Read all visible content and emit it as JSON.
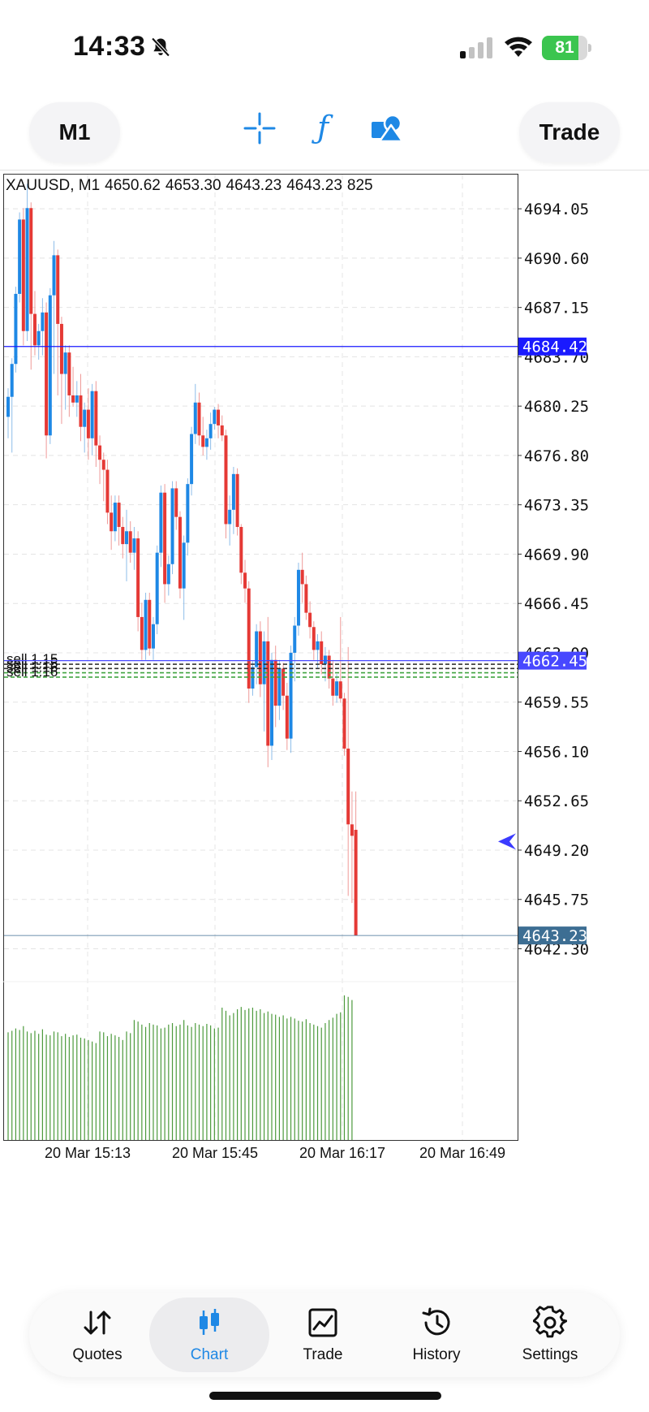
{
  "status_bar": {
    "time": "14:33",
    "battery": "81",
    "battery_level": 0.81,
    "bell_icon": "bell-slash-icon",
    "battery_color": "#3bc54f"
  },
  "toolbar": {
    "timeframe": "M1",
    "trade_label": "Trade",
    "icons": [
      "crosshair-icon",
      "indicator-f-icon",
      "objects-shapes-icon"
    ],
    "accent": "#1e88e5"
  },
  "chart_header": {
    "symbol": "XAUUSD",
    "timeframe": "M1",
    "open": "4650.62",
    "high": "4653.30",
    "low": "4643.23",
    "close": "4643.23",
    "volume": "825"
  },
  "chart_data": {
    "type": "candlestick",
    "symbol": "XAUUSD",
    "y_axis_ticks": [
      "4694.05",
      "4690.60",
      "4687.15",
      "4683.70",
      "4680.25",
      "4676.80",
      "4673.35",
      "4669.90",
      "4666.45",
      "4663.00",
      "4659.55",
      "4656.10",
      "4652.65",
      "4649.20",
      "4645.75",
      "4642.30"
    ],
    "ylim": [
      4640,
      4696.5
    ],
    "x_axis_labels": [
      "20 Mar 15:13",
      "20 Mar 15:45",
      "20 Mar 16:17",
      "20 Mar 16:49"
    ],
    "price_lines": [
      {
        "label": "4684.42",
        "value": 4684.42,
        "color": "#1a1aff"
      },
      {
        "label": "4662.45",
        "value": 4662.45,
        "color": "#4848ff"
      },
      {
        "label": "4643.23",
        "value": 4643.23,
        "color": "#3d6e93"
      }
    ],
    "order_lines": [
      {
        "label": "sell 1.15",
        "value": 4662.2
      },
      {
        "label": "sell 1.15",
        "value": 4661.9
      },
      {
        "label": "sell 1.16",
        "value": 4661.6
      },
      {
        "label": "sell 1.16",
        "value": 4661.3
      }
    ],
    "up_color": "#1e88e5",
    "down_color": "#e53935",
    "volume_color": "#4c9a3c",
    "grid": true,
    "candles": [
      {
        "o": 4679.5,
        "h": 4681.5,
        "l": 4678.0,
        "c": 4680.9
      },
      {
        "o": 4680.9,
        "h": 4683.6,
        "l": 4677.0,
        "c": 4683.2
      },
      {
        "o": 4683.2,
        "h": 4688.6,
        "l": 4682.6,
        "c": 4688.1
      },
      {
        "o": 4688.1,
        "h": 4693.8,
        "l": 4687.5,
        "c": 4693.3
      },
      {
        "o": 4693.3,
        "h": 4694.1,
        "l": 4684.5,
        "c": 4685.5
      },
      {
        "o": 4685.5,
        "h": 4695.8,
        "l": 4684.8,
        "c": 4694.1
      },
      {
        "o": 4694.1,
        "h": 4694.5,
        "l": 4682.8,
        "c": 4686.7
      },
      {
        "o": 4686.7,
        "h": 4688.3,
        "l": 4683.8,
        "c": 4684.5
      },
      {
        "o": 4684.5,
        "h": 4686.0,
        "l": 4683.5,
        "c": 4685.5
      },
      {
        "o": 4685.5,
        "h": 4687.8,
        "l": 4683.8,
        "c": 4686.8
      },
      {
        "o": 4686.8,
        "h": 4687.5,
        "l": 4676.6,
        "c": 4678.2
      },
      {
        "o": 4678.2,
        "h": 4688.5,
        "l": 4677.6,
        "c": 4688.0
      },
      {
        "o": 4688.0,
        "h": 4691.8,
        "l": 4682.5,
        "c": 4690.8
      },
      {
        "o": 4690.8,
        "h": 4691.2,
        "l": 4681.0,
        "c": 4686.0
      },
      {
        "o": 4686.0,
        "h": 4686.5,
        "l": 4679.0,
        "c": 4682.5
      },
      {
        "o": 4682.5,
        "h": 4684.5,
        "l": 4680.0,
        "c": 4684.0
      },
      {
        "o": 4684.0,
        "h": 4684.5,
        "l": 4679.5,
        "c": 4681.0
      },
      {
        "o": 4681.0,
        "h": 4683.0,
        "l": 4680.2,
        "c": 4680.5
      },
      {
        "o": 4680.5,
        "h": 4682.0,
        "l": 4679.5,
        "c": 4681.0
      },
      {
        "o": 4681.0,
        "h": 4682.5,
        "l": 4677.8,
        "c": 4678.8
      },
      {
        "o": 4678.8,
        "h": 4680.5,
        "l": 4677.0,
        "c": 4680.0
      },
      {
        "o": 4680.0,
        "h": 4681.5,
        "l": 4676.5,
        "c": 4678.0
      },
      {
        "o": 4678.0,
        "h": 4681.8,
        "l": 4676.8,
        "c": 4681.3
      },
      {
        "o": 4681.3,
        "h": 4682.0,
        "l": 4676.0,
        "c": 4677.5
      },
      {
        "o": 4677.5,
        "h": 4678.2,
        "l": 4674.8,
        "c": 4676.5
      },
      {
        "o": 4676.5,
        "h": 4677.0,
        "l": 4673.6,
        "c": 4675.8
      },
      {
        "o": 4675.8,
        "h": 4676.5,
        "l": 4672.0,
        "c": 4672.8
      },
      {
        "o": 4672.8,
        "h": 4674.0,
        "l": 4670.2,
        "c": 4671.5
      },
      {
        "o": 4671.5,
        "h": 4674.0,
        "l": 4670.8,
        "c": 4673.5
      },
      {
        "o": 4673.5,
        "h": 4674.0,
        "l": 4670.5,
        "c": 4671.8
      },
      {
        "o": 4671.8,
        "h": 4672.5,
        "l": 4669.6,
        "c": 4670.6
      },
      {
        "o": 4670.6,
        "h": 4673.0,
        "l": 4668.0,
        "c": 4671.5
      },
      {
        "o": 4671.5,
        "h": 4672.2,
        "l": 4669.3,
        "c": 4670.0
      },
      {
        "o": 4670.0,
        "h": 4671.8,
        "l": 4668.8,
        "c": 4671.0
      },
      {
        "o": 4671.0,
        "h": 4671.5,
        "l": 4664.5,
        "c": 4665.5
      },
      {
        "o": 4665.5,
        "h": 4666.5,
        "l": 4662.5,
        "c": 4663.2
      },
      {
        "o": 4663.2,
        "h": 4667.2,
        "l": 4662.5,
        "c": 4666.7
      },
      {
        "o": 4666.7,
        "h": 4667.2,
        "l": 4662.8,
        "c": 4663.3
      },
      {
        "o": 4663.3,
        "h": 4665.5,
        "l": 4662.5,
        "c": 4665.0
      },
      {
        "o": 4665.0,
        "h": 4670.5,
        "l": 4664.3,
        "c": 4670.0
      },
      {
        "o": 4670.0,
        "h": 4674.7,
        "l": 4669.0,
        "c": 4674.2
      },
      {
        "o": 4674.2,
        "h": 4674.8,
        "l": 4666.5,
        "c": 4667.8
      },
      {
        "o": 4667.8,
        "h": 4669.8,
        "l": 4667.0,
        "c": 4669.2
      },
      {
        "o": 4669.2,
        "h": 4675.0,
        "l": 4668.5,
        "c": 4674.5
      },
      {
        "o": 4674.5,
        "h": 4675.0,
        "l": 4671.6,
        "c": 4672.5
      },
      {
        "o": 4672.5,
        "h": 4672.9,
        "l": 4666.8,
        "c": 4667.5
      },
      {
        "o": 4667.5,
        "h": 4671.2,
        "l": 4665.3,
        "c": 4670.7
      },
      {
        "o": 4670.7,
        "h": 4675.2,
        "l": 4669.8,
        "c": 4674.8
      },
      {
        "o": 4674.8,
        "h": 4678.8,
        "l": 4674.0,
        "c": 4678.3
      },
      {
        "o": 4678.3,
        "h": 4681.8,
        "l": 4677.6,
        "c": 4680.5
      },
      {
        "o": 4680.5,
        "h": 4681.2,
        "l": 4677.5,
        "c": 4678.2
      },
      {
        "o": 4678.2,
        "h": 4679.5,
        "l": 4676.8,
        "c": 4677.4
      },
      {
        "o": 4677.4,
        "h": 4678.6,
        "l": 4676.5,
        "c": 4678.0
      },
      {
        "o": 4678.0,
        "h": 4679.8,
        "l": 4677.2,
        "c": 4679.0
      },
      {
        "o": 4679.0,
        "h": 4680.2,
        "l": 4678.6,
        "c": 4680.0
      },
      {
        "o": 4680.0,
        "h": 4680.4,
        "l": 4678.0,
        "c": 4678.9
      },
      {
        "o": 4678.9,
        "h": 4679.6,
        "l": 4677.8,
        "c": 4678.2
      },
      {
        "o": 4678.2,
        "h": 4678.6,
        "l": 4671.0,
        "c": 4672.0
      },
      {
        "o": 4672.0,
        "h": 4674.0,
        "l": 4670.5,
        "c": 4673.0
      },
      {
        "o": 4673.0,
        "h": 4676.0,
        "l": 4671.3,
        "c": 4675.5
      },
      {
        "o": 4675.5,
        "h": 4675.9,
        "l": 4671.2,
        "c": 4671.8
      },
      {
        "o": 4671.8,
        "h": 4672.0,
        "l": 4667.8,
        "c": 4668.6
      },
      {
        "o": 4668.6,
        "h": 4669.5,
        "l": 4666.5,
        "c": 4667.5
      },
      {
        "o": 4667.5,
        "h": 4668.0,
        "l": 4659.5,
        "c": 4660.5
      },
      {
        "o": 4660.5,
        "h": 4662.4,
        "l": 4660.0,
        "c": 4662.0
      },
      {
        "o": 4662.0,
        "h": 4665.0,
        "l": 4660.8,
        "c": 4664.5
      },
      {
        "o": 4664.5,
        "h": 4665.2,
        "l": 4659.9,
        "c": 4660.8
      },
      {
        "o": 4660.8,
        "h": 4664.5,
        "l": 4657.5,
        "c": 4663.8
      },
      {
        "o": 4663.8,
        "h": 4665.5,
        "l": 4655.0,
        "c": 4656.5
      },
      {
        "o": 4656.5,
        "h": 4663.0,
        "l": 4655.5,
        "c": 4662.5
      },
      {
        "o": 4662.5,
        "h": 4663.5,
        "l": 4657.8,
        "c": 4659.3
      },
      {
        "o": 4659.3,
        "h": 4662.5,
        "l": 4658.3,
        "c": 4661.9
      },
      {
        "o": 4661.9,
        "h": 4662.3,
        "l": 4659.0,
        "c": 4660.0
      },
      {
        "o": 4660.0,
        "h": 4660.9,
        "l": 4656.2,
        "c": 4657.0
      },
      {
        "o": 4657.0,
        "h": 4663.5,
        "l": 4656.0,
        "c": 4663.0
      },
      {
        "o": 4663.0,
        "h": 4665.5,
        "l": 4661.0,
        "c": 4664.9
      },
      {
        "o": 4664.9,
        "h": 4669.3,
        "l": 4664.2,
        "c": 4668.8
      },
      {
        "o": 4668.8,
        "h": 4670.0,
        "l": 4666.5,
        "c": 4667.8
      },
      {
        "o": 4667.8,
        "h": 4668.4,
        "l": 4665.3,
        "c": 4665.8
      },
      {
        "o": 4665.8,
        "h": 4666.6,
        "l": 4664.0,
        "c": 4664.8
      },
      {
        "o": 4664.8,
        "h": 4665.2,
        "l": 4662.5,
        "c": 4663.2
      },
      {
        "o": 4663.2,
        "h": 4664.3,
        "l": 4661.9,
        "c": 4663.8
      },
      {
        "o": 4663.8,
        "h": 4664.5,
        "l": 4661.5,
        "c": 4662.2
      },
      {
        "o": 4662.2,
        "h": 4663.4,
        "l": 4661.0,
        "c": 4662.8
      },
      {
        "o": 4662.8,
        "h": 4663.2,
        "l": 4660.5,
        "c": 4661.2
      },
      {
        "o": 4661.2,
        "h": 4662.5,
        "l": 4659.3,
        "c": 4660.0
      },
      {
        "o": 4660.0,
        "h": 4661.5,
        "l": 4659.5,
        "c": 4661.0
      },
      {
        "o": 4661.0,
        "h": 4665.5,
        "l": 4659.5,
        "c": 4659.8
      },
      {
        "o": 4659.8,
        "h": 4660.2,
        "l": 4655.8,
        "c": 4656.3
      },
      {
        "o": 4656.3,
        "h": 4663.4,
        "l": 4646.0,
        "c": 4651.0
      },
      {
        "o": 4651.0,
        "h": 4653.3,
        "l": 4645.5,
        "c": 4650.2
      },
      {
        "o": 4650.62,
        "h": 4653.3,
        "l": 4643.23,
        "c": 4643.23
      }
    ],
    "volumes": [
      140,
      142,
      145,
      143,
      148,
      141,
      139,
      142,
      138,
      144,
      137,
      136,
      141,
      140,
      135,
      138,
      134,
      136,
      137,
      133,
      132,
      130,
      128,
      126,
      141,
      140,
      135,
      138,
      136,
      134,
      130,
      141,
      139,
      156,
      154,
      150,
      147,
      152,
      150,
      149,
      145,
      146,
      150,
      152,
      148,
      150,
      156,
      149,
      147,
      152,
      150,
      148,
      151,
      149,
      145,
      146,
      172,
      168,
      162,
      165,
      170,
      173,
      169,
      171,
      172,
      168,
      170,
      165,
      167,
      164,
      163,
      160,
      162,
      158,
      160,
      158,
      155,
      154,
      157,
      152,
      150,
      148,
      146,
      152,
      156,
      159,
      164,
      166,
      188,
      186,
      182
    ]
  },
  "tabs": [
    {
      "label": "Quotes",
      "icon": "quotes-arrows-icon",
      "active": false
    },
    {
      "label": "Chart",
      "icon": "candlestick-icon",
      "active": true
    },
    {
      "label": "Trade",
      "icon": "trade-chart-icon",
      "active": false
    },
    {
      "label": "History",
      "icon": "history-clock-icon",
      "active": false
    },
    {
      "label": "Settings",
      "icon": "gear-icon",
      "active": false
    }
  ]
}
